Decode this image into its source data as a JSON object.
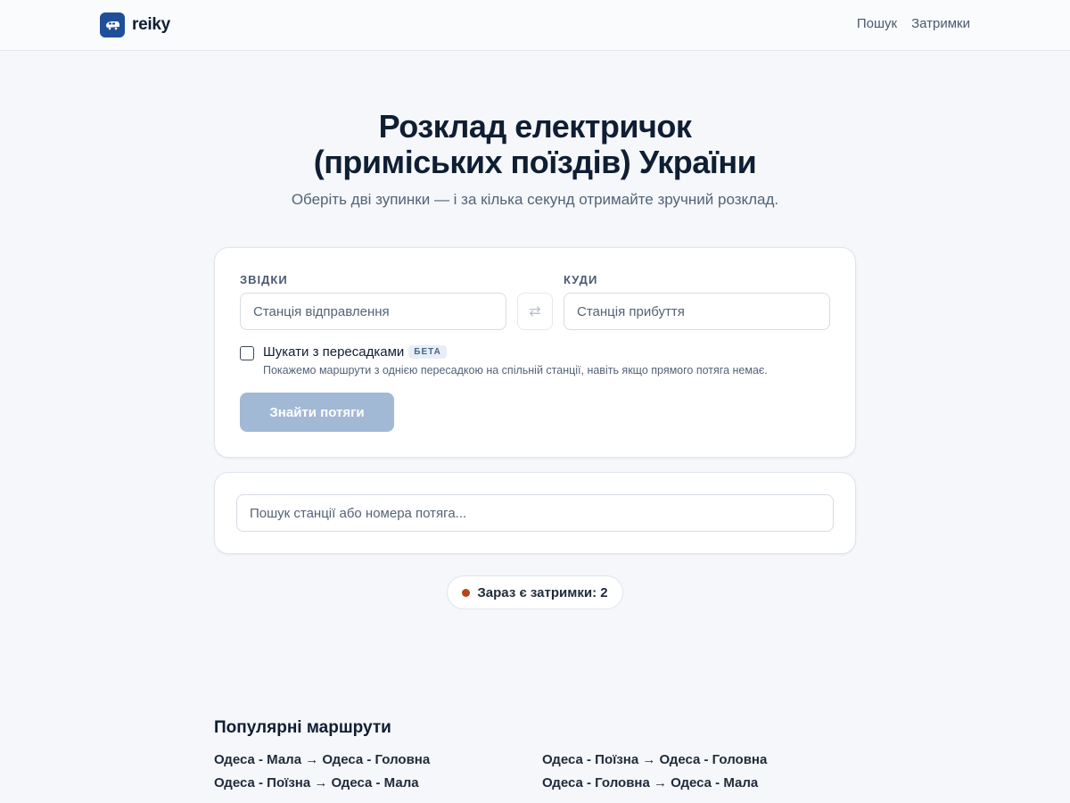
{
  "header": {
    "logo_text": "reiky",
    "nav": [
      {
        "label": "Пошук"
      },
      {
        "label": "Затримки"
      }
    ]
  },
  "hero": {
    "title_line1": "Розклад електричок",
    "title_line2": "(приміських поїздів) України",
    "subtitle": "Оберіть дві зупинки — і за кілька секунд отримайте зручний розклад."
  },
  "search_form": {
    "from_label": "ЗВІДКИ",
    "from_placeholder": "Станція відправлення",
    "to_label": "КУДИ",
    "to_placeholder": "Станція прибуття",
    "transfers_label": "Шукати з пересадками",
    "beta_badge": "БЕТА",
    "transfers_hint": "Покажемо маршрути з однією пересадкою на спільній станції, навіть якщо прямого потяга немає.",
    "transfers_checked": false,
    "submit_label": "Знайти потяги"
  },
  "quick_search": {
    "placeholder": "Пошук станції або номера потяга..."
  },
  "delays": {
    "label": "Зараз є затримки: 2",
    "dot_color": "#b4441a"
  },
  "popular": {
    "title": "Популярні маршрути",
    "routes": [
      {
        "label": "Одеса - Мала → Одеса - Головна"
      },
      {
        "label": "Одеса - Поїзна → Одеса - Головна"
      },
      {
        "label": "Одеса - Поїзна → Одеса - Мала"
      },
      {
        "label": "Одеса - Головна → Одеса - Мала"
      }
    ]
  },
  "colors": {
    "brand": "#1f4f99",
    "button_disabled": "#a2b9d6",
    "background": "#f5f7fa"
  }
}
